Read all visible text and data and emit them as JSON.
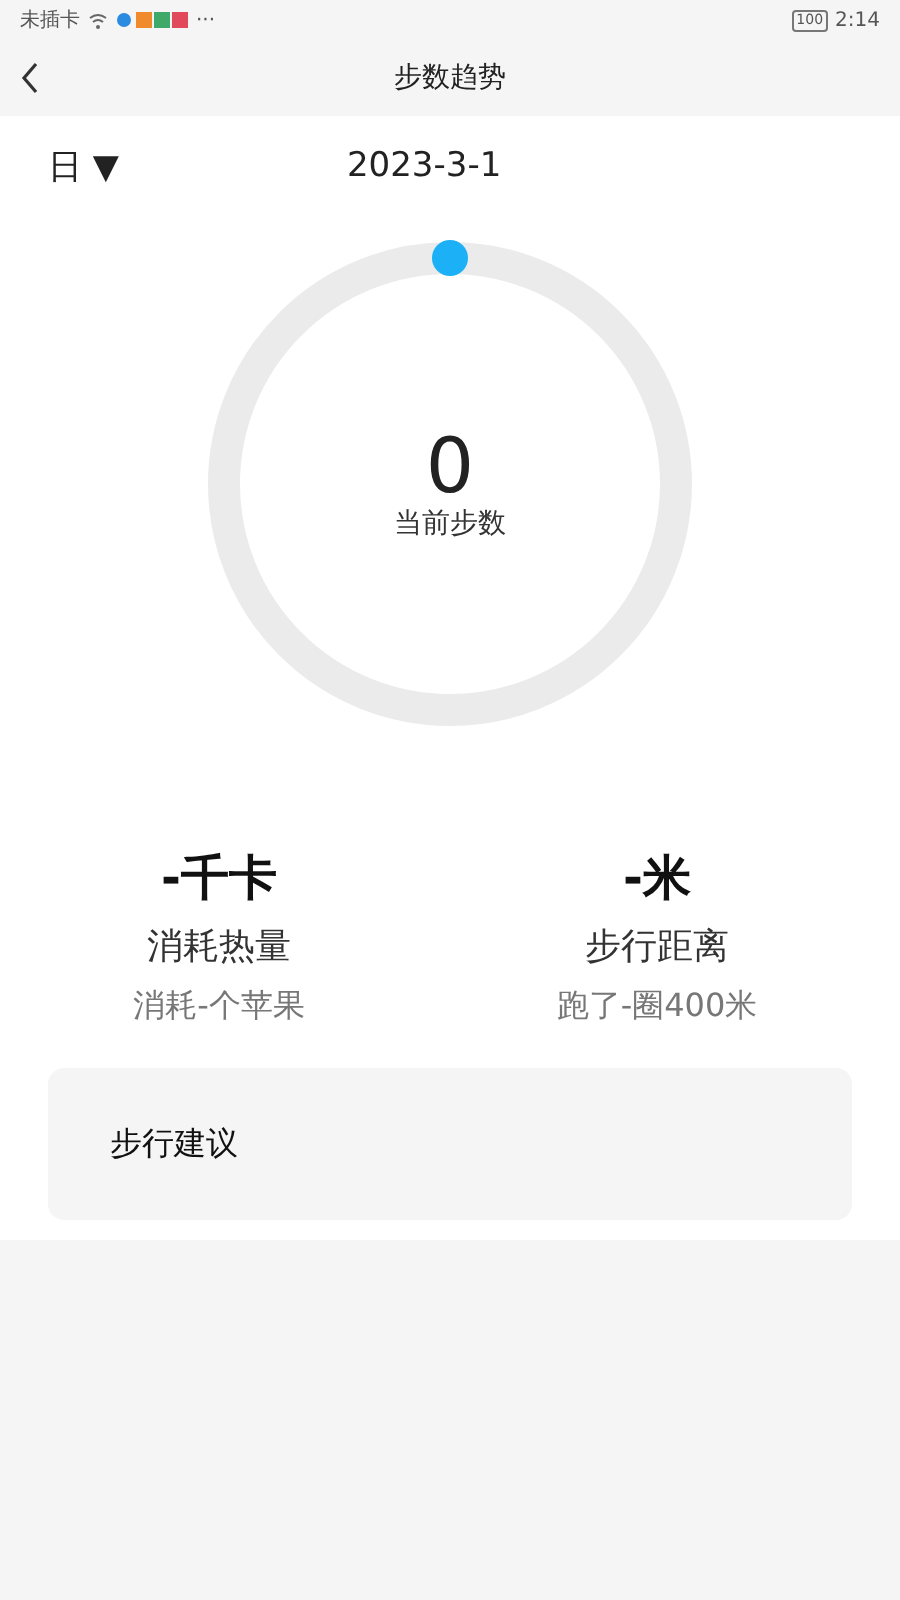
{
  "status_bar": {
    "carrier": "未插卡",
    "more": "···",
    "battery": "100",
    "time": "2:14"
  },
  "header": {
    "title": "步数趋势"
  },
  "period": {
    "label": "日",
    "caret": "▼"
  },
  "date": "2023-3-1",
  "ring": {
    "value": "0",
    "label": "当前步数"
  },
  "stats": [
    {
      "value": "-千卡",
      "label": "消耗热量",
      "note": "消耗-个苹果"
    },
    {
      "value": "-米",
      "label": "步行距离",
      "note": "跑了-圈400米"
    }
  ],
  "advice": {
    "title": "步行建议"
  }
}
